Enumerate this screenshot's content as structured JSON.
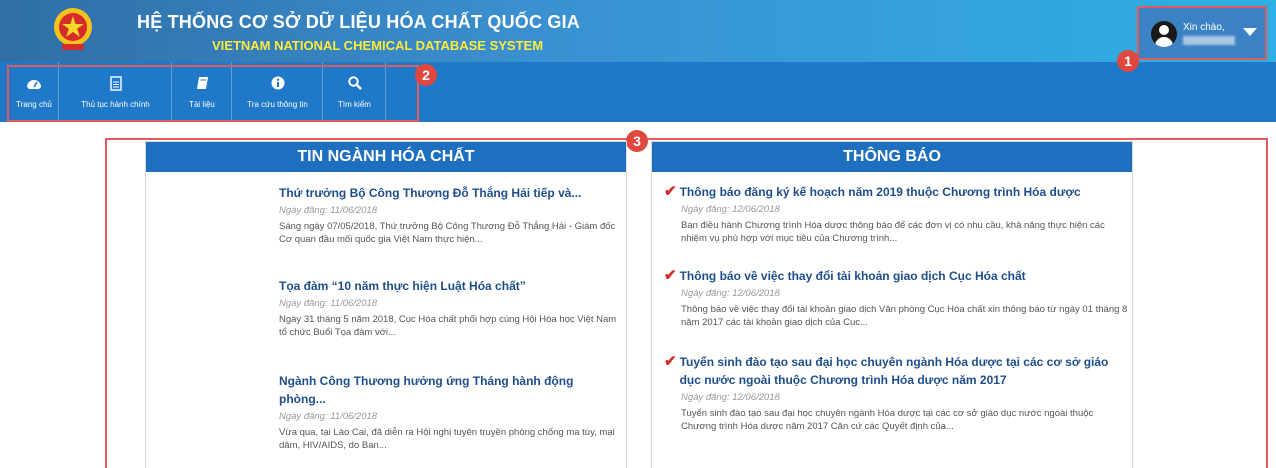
{
  "header": {
    "title": "HỆ THỐNG CƠ SỞ DỮ LIỆU HÓA CHẤT QUỐC GIA",
    "subtitle": "VIETNAM NATIONAL CHEMICAL DATABASE SYSTEM",
    "greeting": "Xin chào,"
  },
  "nav": [
    {
      "label": "Trang chủ",
      "icon": "dashboard-icon"
    },
    {
      "label": "Thủ tục hành chính",
      "icon": "document-icon"
    },
    {
      "label": "Tài liệu",
      "icon": "book-icon"
    },
    {
      "label": "Tra cứu thông tin",
      "icon": "info-icon"
    },
    {
      "label": "Tìm kiếm",
      "icon": "search-icon"
    }
  ],
  "badges": [
    "1",
    "2",
    "3"
  ],
  "news_panel": {
    "title": "TIN NGÀNH HÓA CHẤT",
    "items": [
      {
        "title": "Thứ trưởng Bộ Công Thương Đỗ Thắng Hải tiếp và...",
        "date": "Ngày đăng: 11/06/2018",
        "summary": "Sáng ngày 07/05/2018, Thứ trưởng Bộ Công Thương Đỗ Thắng Hải - Giám đốc Cơ quan đầu mối quốc gia Việt Nam thực hiện..."
      },
      {
        "title": "Tọa đàm “10 năm thực hiện Luật Hóa chất”",
        "date": "Ngày đăng: 11/06/2018",
        "summary": "Ngày 31 tháng 5 năm 2018, Cục Hóa chất phối hợp cùng Hội Hóa học Việt Nam tổ chức Buổi Tọa đàm với..."
      },
      {
        "title": "Ngành Công Thương hưởng ứng Tháng hành động phòng...",
        "date": "Ngày đăng: 11/06/2018",
        "summary": "Vừa qua, tại Lào Cai, đã diễn ra Hội nghị tuyên truyền phòng chống ma túy, mại dâm, HIV/AIDS, do Ban..."
      }
    ]
  },
  "notice_panel": {
    "title": "THÔNG BÁO",
    "items": [
      {
        "title": "Thông báo đăng ký kế hoạch năm 2019 thuộc Chương trình Hóa dược",
        "date": "Ngày đăng: 12/06/2018",
        "summary": "Ban điều hành Chương trình Hóa dược thông báo để các đơn vị có nhu cầu, khả năng thực hiện các nhiệm vụ phù hợp với mục tiêu của Chương trình..."
      },
      {
        "title": "Thông báo về việc thay đổi tài khoản giao dịch Cục Hóa chất",
        "date": "Ngày đăng: 12/06/2018",
        "summary": "Thông báo về việc thay đổi tài khoản giao dịch Văn phòng Cục Hóa chất xin thông báo từ ngày 01 tháng 8 năm 2017 các tài khoản giao dịch của Cục..."
      },
      {
        "title": "Tuyển sinh đào tạo sau đại học chuyên ngành Hóa dược tại các cơ sở giáo dục nước ngoài thuộc Chương trình Hóa dược năm 2017",
        "date": "Ngày đăng: 12/06/2018",
        "summary": "Tuyển sinh đào tạo sau đại học chuyên ngành Hóa dược tại các cơ sở giáo dục nước ngoài thuộc Chương trình Hóa dược năm 2017 Căn cứ các Quyết định của..."
      }
    ]
  },
  "colors": {
    "header_start": "#2f6ea6",
    "header_end": "#2fb0e4",
    "nav": "#1f78c8",
    "panel_head": "#1e6fc0",
    "annotation": "#e25b5b",
    "check": "#d12a2a",
    "subtitle": "#ffeb3b"
  }
}
